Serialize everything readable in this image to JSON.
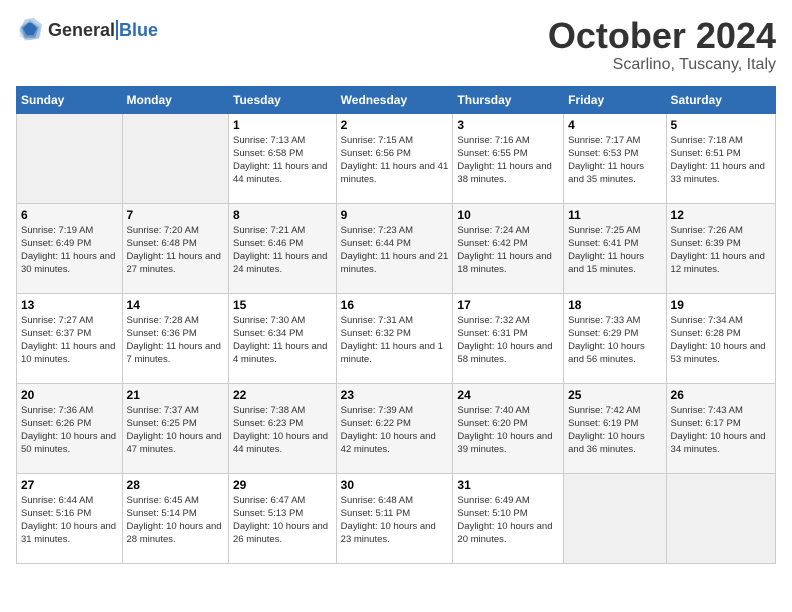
{
  "header": {
    "logo_general": "General",
    "logo_blue": "Blue",
    "month_title": "October 2024",
    "location": "Scarlino, Tuscany, Italy"
  },
  "weekdays": [
    "Sunday",
    "Monday",
    "Tuesday",
    "Wednesday",
    "Thursday",
    "Friday",
    "Saturday"
  ],
  "weeks": [
    [
      {
        "day": "",
        "empty": true
      },
      {
        "day": "",
        "empty": true
      },
      {
        "day": "1",
        "sunrise": "Sunrise: 7:13 AM",
        "sunset": "Sunset: 6:58 PM",
        "daylight": "Daylight: 11 hours and 44 minutes."
      },
      {
        "day": "2",
        "sunrise": "Sunrise: 7:15 AM",
        "sunset": "Sunset: 6:56 PM",
        "daylight": "Daylight: 11 hours and 41 minutes."
      },
      {
        "day": "3",
        "sunrise": "Sunrise: 7:16 AM",
        "sunset": "Sunset: 6:55 PM",
        "daylight": "Daylight: 11 hours and 38 minutes."
      },
      {
        "day": "4",
        "sunrise": "Sunrise: 7:17 AM",
        "sunset": "Sunset: 6:53 PM",
        "daylight": "Daylight: 11 hours and 35 minutes."
      },
      {
        "day": "5",
        "sunrise": "Sunrise: 7:18 AM",
        "sunset": "Sunset: 6:51 PM",
        "daylight": "Daylight: 11 hours and 33 minutes."
      }
    ],
    [
      {
        "day": "6",
        "sunrise": "Sunrise: 7:19 AM",
        "sunset": "Sunset: 6:49 PM",
        "daylight": "Daylight: 11 hours and 30 minutes."
      },
      {
        "day": "7",
        "sunrise": "Sunrise: 7:20 AM",
        "sunset": "Sunset: 6:48 PM",
        "daylight": "Daylight: 11 hours and 27 minutes."
      },
      {
        "day": "8",
        "sunrise": "Sunrise: 7:21 AM",
        "sunset": "Sunset: 6:46 PM",
        "daylight": "Daylight: 11 hours and 24 minutes."
      },
      {
        "day": "9",
        "sunrise": "Sunrise: 7:23 AM",
        "sunset": "Sunset: 6:44 PM",
        "daylight": "Daylight: 11 hours and 21 minutes."
      },
      {
        "day": "10",
        "sunrise": "Sunrise: 7:24 AM",
        "sunset": "Sunset: 6:42 PM",
        "daylight": "Daylight: 11 hours and 18 minutes."
      },
      {
        "day": "11",
        "sunrise": "Sunrise: 7:25 AM",
        "sunset": "Sunset: 6:41 PM",
        "daylight": "Daylight: 11 hours and 15 minutes."
      },
      {
        "day": "12",
        "sunrise": "Sunrise: 7:26 AM",
        "sunset": "Sunset: 6:39 PM",
        "daylight": "Daylight: 11 hours and 12 minutes."
      }
    ],
    [
      {
        "day": "13",
        "sunrise": "Sunrise: 7:27 AM",
        "sunset": "Sunset: 6:37 PM",
        "daylight": "Daylight: 11 hours and 10 minutes."
      },
      {
        "day": "14",
        "sunrise": "Sunrise: 7:28 AM",
        "sunset": "Sunset: 6:36 PM",
        "daylight": "Daylight: 11 hours and 7 minutes."
      },
      {
        "day": "15",
        "sunrise": "Sunrise: 7:30 AM",
        "sunset": "Sunset: 6:34 PM",
        "daylight": "Daylight: 11 hours and 4 minutes."
      },
      {
        "day": "16",
        "sunrise": "Sunrise: 7:31 AM",
        "sunset": "Sunset: 6:32 PM",
        "daylight": "Daylight: 11 hours and 1 minute."
      },
      {
        "day": "17",
        "sunrise": "Sunrise: 7:32 AM",
        "sunset": "Sunset: 6:31 PM",
        "daylight": "Daylight: 10 hours and 58 minutes."
      },
      {
        "day": "18",
        "sunrise": "Sunrise: 7:33 AM",
        "sunset": "Sunset: 6:29 PM",
        "daylight": "Daylight: 10 hours and 56 minutes."
      },
      {
        "day": "19",
        "sunrise": "Sunrise: 7:34 AM",
        "sunset": "Sunset: 6:28 PM",
        "daylight": "Daylight: 10 hours and 53 minutes."
      }
    ],
    [
      {
        "day": "20",
        "sunrise": "Sunrise: 7:36 AM",
        "sunset": "Sunset: 6:26 PM",
        "daylight": "Daylight: 10 hours and 50 minutes."
      },
      {
        "day": "21",
        "sunrise": "Sunrise: 7:37 AM",
        "sunset": "Sunset: 6:25 PM",
        "daylight": "Daylight: 10 hours and 47 minutes."
      },
      {
        "day": "22",
        "sunrise": "Sunrise: 7:38 AM",
        "sunset": "Sunset: 6:23 PM",
        "daylight": "Daylight: 10 hours and 44 minutes."
      },
      {
        "day": "23",
        "sunrise": "Sunrise: 7:39 AM",
        "sunset": "Sunset: 6:22 PM",
        "daylight": "Daylight: 10 hours and 42 minutes."
      },
      {
        "day": "24",
        "sunrise": "Sunrise: 7:40 AM",
        "sunset": "Sunset: 6:20 PM",
        "daylight": "Daylight: 10 hours and 39 minutes."
      },
      {
        "day": "25",
        "sunrise": "Sunrise: 7:42 AM",
        "sunset": "Sunset: 6:19 PM",
        "daylight": "Daylight: 10 hours and 36 minutes."
      },
      {
        "day": "26",
        "sunrise": "Sunrise: 7:43 AM",
        "sunset": "Sunset: 6:17 PM",
        "daylight": "Daylight: 10 hours and 34 minutes."
      }
    ],
    [
      {
        "day": "27",
        "sunrise": "Sunrise: 6:44 AM",
        "sunset": "Sunset: 5:16 PM",
        "daylight": "Daylight: 10 hours and 31 minutes."
      },
      {
        "day": "28",
        "sunrise": "Sunrise: 6:45 AM",
        "sunset": "Sunset: 5:14 PM",
        "daylight": "Daylight: 10 hours and 28 minutes."
      },
      {
        "day": "29",
        "sunrise": "Sunrise: 6:47 AM",
        "sunset": "Sunset: 5:13 PM",
        "daylight": "Daylight: 10 hours and 26 minutes."
      },
      {
        "day": "30",
        "sunrise": "Sunrise: 6:48 AM",
        "sunset": "Sunset: 5:11 PM",
        "daylight": "Daylight: 10 hours and 23 minutes."
      },
      {
        "day": "31",
        "sunrise": "Sunrise: 6:49 AM",
        "sunset": "Sunset: 5:10 PM",
        "daylight": "Daylight: 10 hours and 20 minutes."
      },
      {
        "day": "",
        "empty": true
      },
      {
        "day": "",
        "empty": true
      }
    ]
  ]
}
